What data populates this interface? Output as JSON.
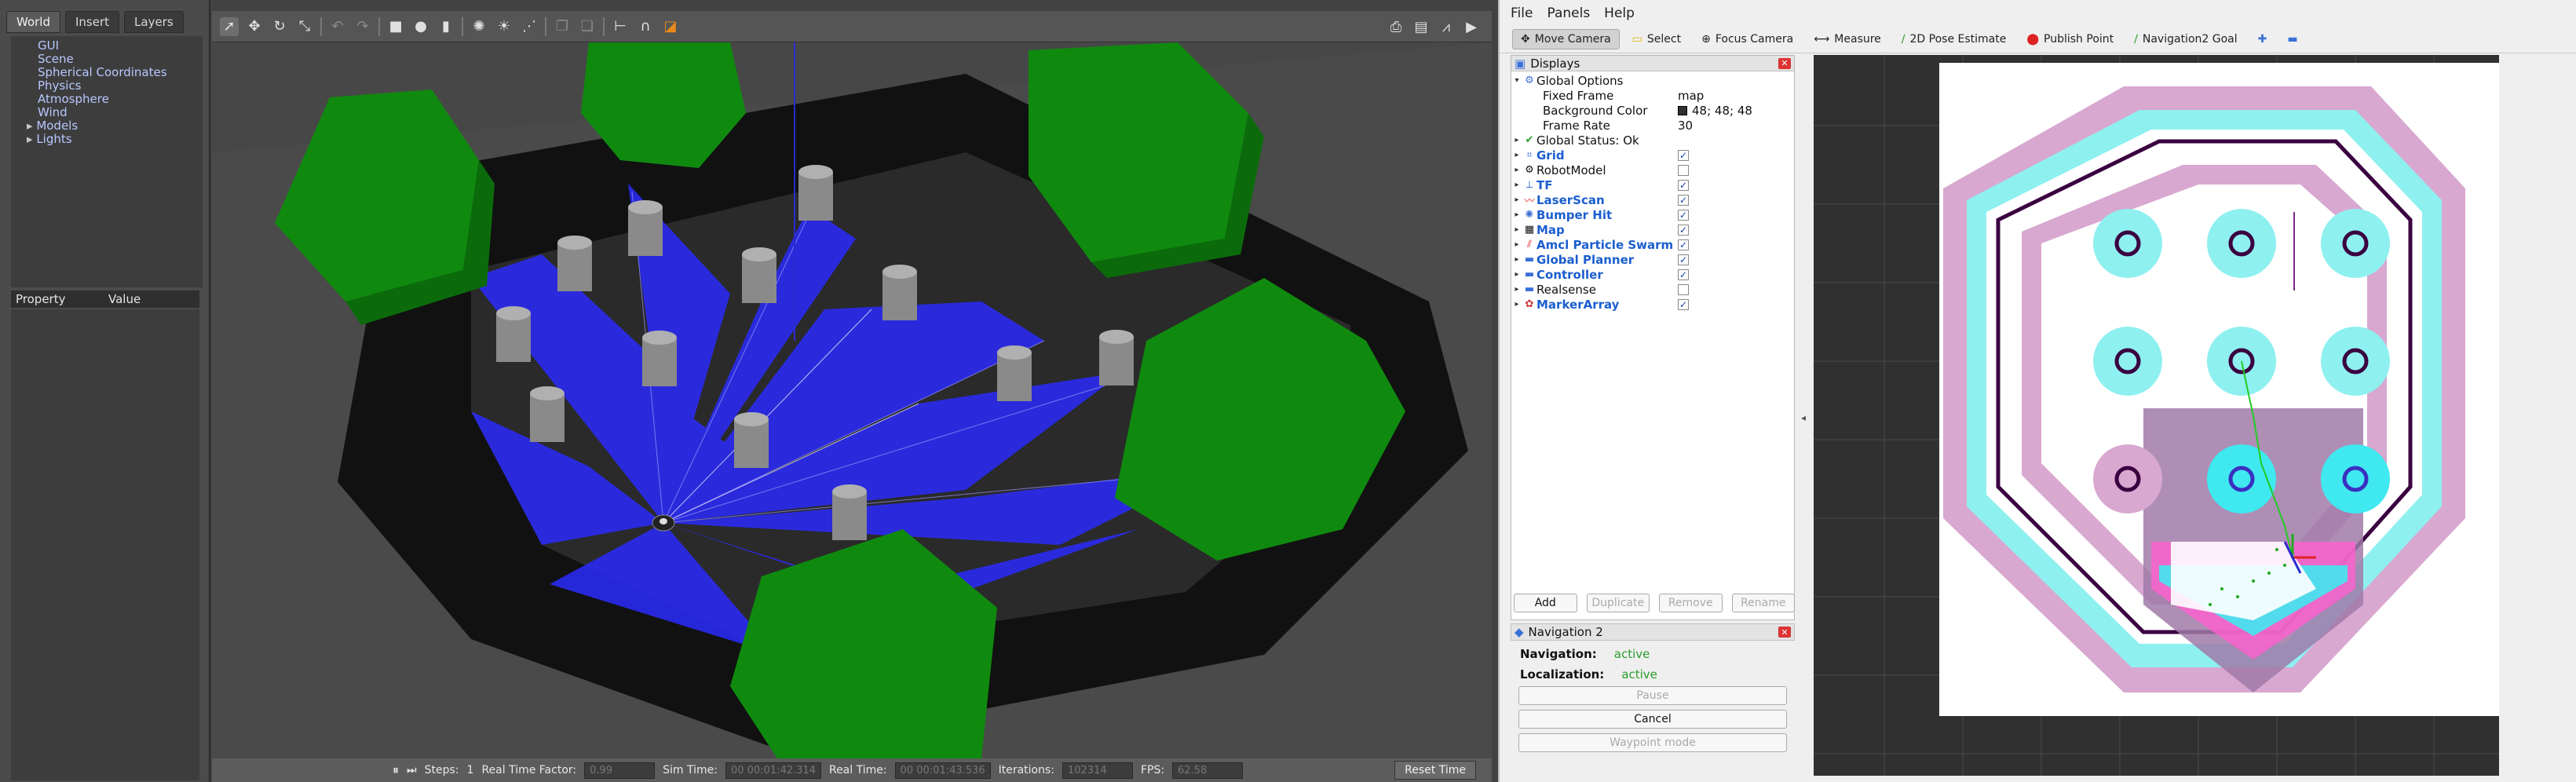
{
  "gazebo": {
    "tabs": [
      "World",
      "Insert",
      "Layers"
    ],
    "world_tree": [
      {
        "label": "GUI",
        "expandable": false
      },
      {
        "label": "Scene",
        "expandable": false
      },
      {
        "label": "Spherical Coordinates",
        "expandable": false
      },
      {
        "label": "Physics",
        "expandable": false
      },
      {
        "label": "Atmosphere",
        "expandable": false
      },
      {
        "label": "Wind",
        "expandable": false
      },
      {
        "label": "Models",
        "expandable": true
      },
      {
        "label": "Lights",
        "expandable": true
      }
    ],
    "property_header": {
      "property": "Property",
      "value": "Value"
    },
    "toolbar_icons": [
      "select-arrow-icon",
      "translate-icon",
      "rotate-icon",
      "scale-icon",
      "undo-icon",
      "redo-icon",
      "box-icon",
      "sphere-icon",
      "cylinder-icon",
      "point-light-icon",
      "spot-light-icon",
      "directional-light-icon",
      "copy-icon",
      "paste-icon",
      "align-icon",
      "snap-icon",
      "change-view-icon"
    ],
    "toolbar_right_icons": [
      "screenshot-icon",
      "log-icon",
      "plot-icon",
      "video-icon"
    ],
    "bottom_bar": {
      "steps_label": "Steps:",
      "steps_value": "1",
      "rtf_label": "Real Time Factor:",
      "rtf_value": "0.99",
      "sim_time_label": "Sim Time:",
      "sim_time_value": "00 00:01:42.314",
      "real_time_label": "Real Time:",
      "real_time_value": "00 00:01:43.536",
      "iterations_label": "Iterations:",
      "iterations_value": "102314",
      "fps_label": "FPS:",
      "fps_value": "62.58",
      "reset_label": "Reset Time"
    }
  },
  "rviz": {
    "menu": [
      "File",
      "Panels",
      "Help"
    ],
    "tools": [
      {
        "label": "Move Camera",
        "icon": "move-camera-icon",
        "active": true
      },
      {
        "label": "Select",
        "icon": "select-icon",
        "active": false
      },
      {
        "label": "Focus Camera",
        "icon": "focus-camera-icon",
        "active": false
      },
      {
        "label": "Measure",
        "icon": "measure-icon",
        "active": false
      },
      {
        "label": "2D Pose Estimate",
        "icon": "pose-estimate-icon",
        "active": false
      },
      {
        "label": "Publish Point",
        "icon": "publish-point-icon",
        "active": false
      },
      {
        "label": "Navigation2 Goal",
        "icon": "nav-goal-icon",
        "active": false
      }
    ],
    "displays": {
      "title": "Displays",
      "global_options": {
        "label": "Global Options",
        "fixed_frame_label": "Fixed Frame",
        "fixed_frame_value": "map",
        "bg_label": "Background Color",
        "bg_value": "48; 48; 48",
        "frame_rate_label": "Frame Rate",
        "frame_rate_value": "30"
      },
      "global_status": "Global Status: Ok",
      "items": [
        {
          "name": "Grid",
          "blue": true,
          "checked": true,
          "icon": "grid-icon"
        },
        {
          "name": "RobotModel",
          "blue": false,
          "checked": false,
          "icon": "robot-model-icon"
        },
        {
          "name": "TF",
          "blue": true,
          "checked": true,
          "icon": "tf-icon"
        },
        {
          "name": "LaserScan",
          "blue": true,
          "checked": true,
          "icon": "laser-scan-icon"
        },
        {
          "name": "Bumper Hit",
          "blue": true,
          "checked": true,
          "icon": "bumper-icon"
        },
        {
          "name": "Map",
          "blue": true,
          "checked": true,
          "icon": "map-icon"
        },
        {
          "name": "Amcl Particle Swarm",
          "blue": true,
          "checked": true,
          "icon": "particle-icon"
        },
        {
          "name": "Global Planner",
          "blue": true,
          "checked": true,
          "icon": "folder-icon"
        },
        {
          "name": "Controller",
          "blue": true,
          "checked": true,
          "icon": "folder-icon"
        },
        {
          "name": "Realsense",
          "blue": false,
          "checked": false,
          "icon": "folder-icon"
        },
        {
          "name": "MarkerArray",
          "blue": true,
          "checked": true,
          "icon": "marker-array-icon"
        }
      ],
      "buttons": {
        "add": "Add",
        "duplicate": "Duplicate",
        "remove": "Remove",
        "rename": "Rename"
      }
    },
    "nav_panel": {
      "title": "Navigation 2",
      "navigation_label": "Navigation:",
      "navigation_value": "active",
      "localization_label": "Localization:",
      "localization_value": "active",
      "pause": "Pause",
      "cancel": "Cancel",
      "waypoint": "Waypoint mode"
    },
    "colors": {
      "background": "#303030",
      "accent": "#1b5ecf",
      "active_green": "#2a9d2a"
    }
  }
}
